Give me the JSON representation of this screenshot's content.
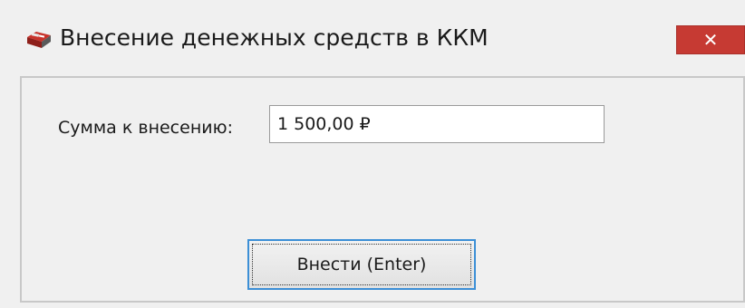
{
  "window": {
    "title": "Внесение денежных средств в ККМ",
    "icon": "cash-register-icon",
    "close_label": "✕"
  },
  "form": {
    "amount_label": "Сумма к внесению:",
    "amount_value": "1 500,00 ₽"
  },
  "actions": {
    "submit_label": "Внести (Enter)"
  },
  "colors": {
    "close_button": "#c63a33",
    "focus_border": "#3c8fd6",
    "window_bg": "#f0f0f0"
  }
}
